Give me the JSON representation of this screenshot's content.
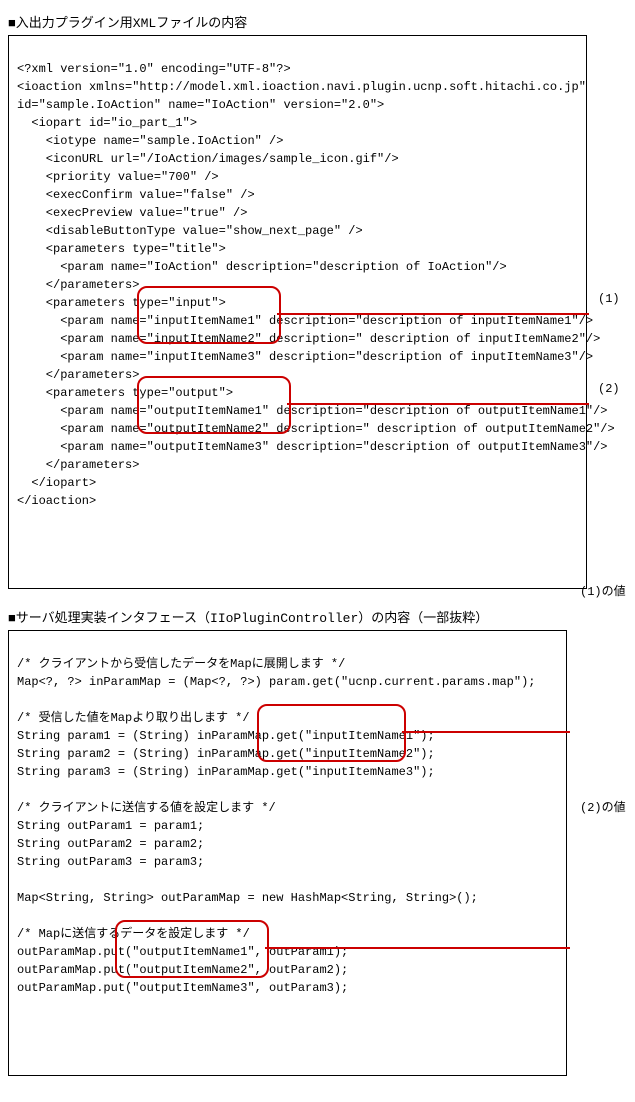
{
  "section1": {
    "title": "■入出力プラグイン用XMLファイルの内容",
    "code": "<?xml version=\"1.0\" encoding=\"UTF-8\"?>\n<ioaction xmlns=\"http://model.xml.ioaction.navi.plugin.ucnp.soft.hitachi.co.jp\"\nid=\"sample.IoAction\" name=\"IoAction\" version=\"2.0\">\n  <iopart id=\"io_part_1\">\n    <iotype name=\"sample.IoAction\" />\n    <iconURL url=\"/IoAction/images/sample_icon.gif\"/>\n    <priority value=\"700\" />\n    <execConfirm value=\"false\" />\n    <execPreview value=\"true\" />\n    <disableButtonType value=\"show_next_page\" />\n    <parameters type=\"title\">\n      <param name=\"IoAction\" description=\"description of IoAction\"/>\n    </parameters>\n    <parameters type=\"input\">\n      <param name=\"inputItemName1\" description=\"description of inputItemName1\"/>\n      <param name=\"inputItemName2\" description=\" description of inputItemName2\"/>\n      <param name=\"inputItemName3\" description=\"description of inputItemName3\"/>\n    </parameters>\n    <parameters type=\"output\">\n      <param name=\"outputItemName1\" description=\"description of outputItemName1\"/>\n      <param name=\"outputItemName2\" description=\" description of outputItemName2\"/>\n      <param name=\"outputItemName3\" description=\"description of outputItemName3\"/>\n    </parameters>\n  </iopart>\n</ioaction>"
  },
  "section2": {
    "title": "■サーバ処理実装インタフェース（IIoPluginController）の内容（一部抜粋）",
    "code": "/* クライアントから受信したデータをMapに展開します */\nMap<?, ?> inParamMap = (Map<?, ?>) param.get(\"ucnp.current.params.map\");\n\n/* 受信した値をMapより取り出します */\nString param1 = (String) inParamMap.get(\"inputItemName1\");\nString param2 = (String) inParamMap.get(\"inputItemName2\");\nString param3 = (String) inParamMap.get(\"inputItemName3\");\n\n/* クライアントに送信する値を設定します */\nString outParam1 = param1;\nString outParam2 = param2;\nString outParam3 = param3;\n\nMap<String, String> outParamMap = new HashMap<String, String>();\n\n/* Mapに送信するデータを設定します */\noutParamMap.put(\"outputItemName1\", outParam1);\noutParamMap.put(\"outputItemName2\", outParam2);\noutParamMap.put(\"outputItemName3\", outParam3);"
  },
  "annotations": {
    "a1": "(1)",
    "a2": "(2)",
    "a1v": "(1)の値",
    "a2v": "(2)の値"
  }
}
